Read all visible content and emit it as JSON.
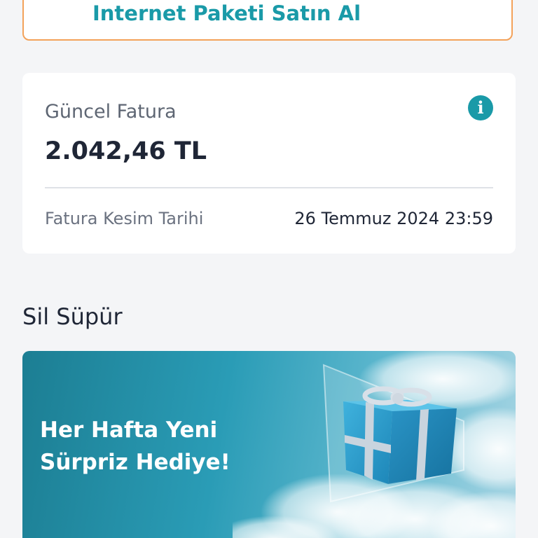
{
  "top_card": {
    "label": "Internet Paketi Satın Al"
  },
  "invoice": {
    "title": "Güncel Fatura",
    "amount": "2.042,46 TL",
    "due_label": "Fatura Kesim Tarihi",
    "due_value": "26 Temmuz 2024 23:59",
    "info_icon": "info-icon"
  },
  "section": {
    "title": "Sil Süpür"
  },
  "banner": {
    "line1": "Her Hafta Yeni",
    "line2": "Sürpriz Hediye!",
    "art": "gift-box-in-clouds"
  },
  "colors": {
    "accent": "#1a9aa8",
    "top_card_border": "#f3a25a",
    "text_dark": "#1f2636",
    "text_muted": "#5e6673"
  }
}
